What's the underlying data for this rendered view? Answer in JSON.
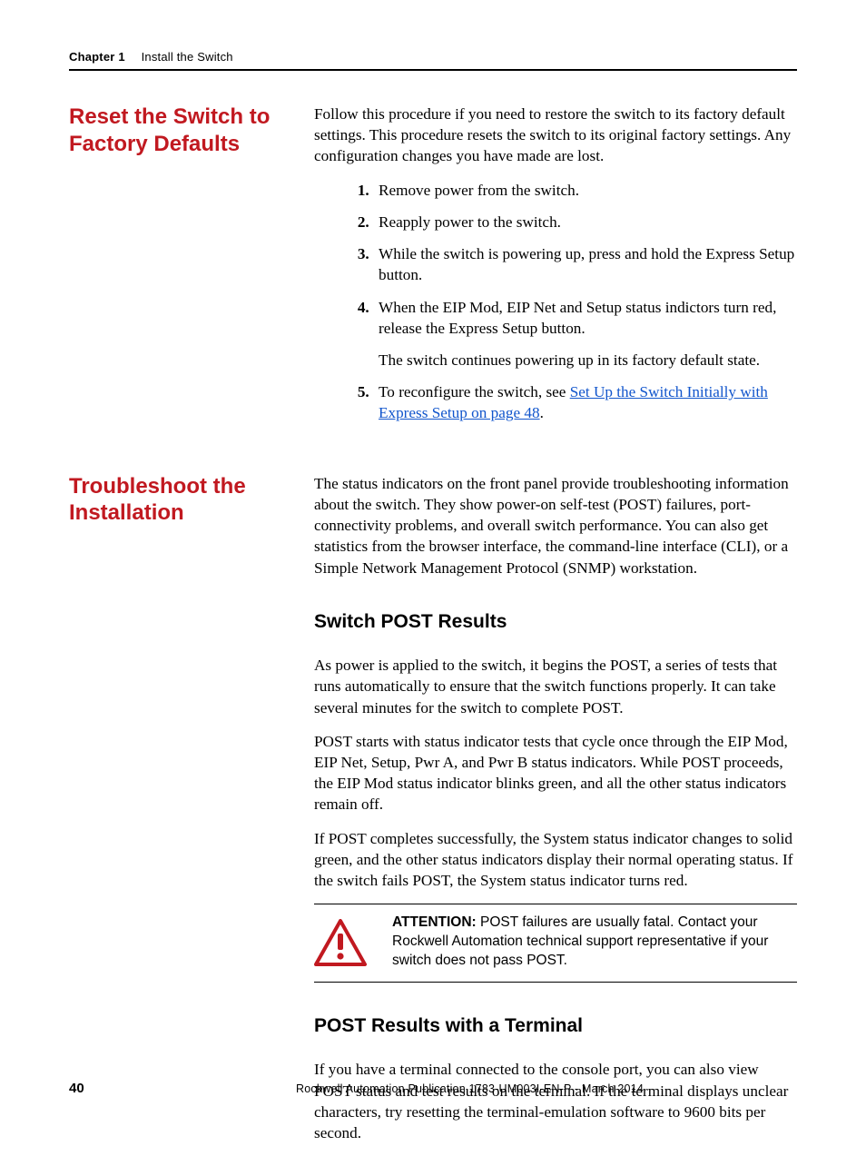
{
  "header": {
    "chapter": "Chapter 1",
    "title": "Install the Switch"
  },
  "section1": {
    "heading": "Reset the Switch to Factory Defaults",
    "intro": "Follow this procedure if you need to restore the switch to its factory default settings. This procedure resets the switch to its original factory settings. Any configuration changes you have made are lost.",
    "steps": {
      "s1": "Remove power from the switch.",
      "s2": "Reapply power to the switch.",
      "s3": "While the switch is powering up, press and hold the Express Setup button.",
      "s4": "When the EIP Mod, EIP Net and Setup status indictors turn red, release the Express Setup button.",
      "s4_cont": "The switch continues powering up in its factory default state.",
      "s5_pre": "To reconfigure the switch, see ",
      "s5_link": "Set Up the Switch Initially with Express Setup on page 48",
      "s5_post": "."
    }
  },
  "section2": {
    "heading": "Troubleshoot the Installation",
    "intro": "The status indicators on the front panel provide troubleshooting information about the switch. They show power-on self-test (POST) failures, port-connectivity problems, and overall switch performance. You can also get statistics from the browser interface, the command-line interface (CLI), or a Simple Network Management Protocol (SNMP) workstation.",
    "sub1": {
      "heading": "Switch POST Results",
      "p1": "As power is applied to the switch, it begins the POST, a series of tests that runs automatically to ensure that the switch functions properly. It can take several minutes for the switch to complete POST.",
      "p2": "POST starts with status indicator tests that cycle once through the EIP Mod, EIP Net, Setup, Pwr A, and Pwr B status indicators. While POST proceeds, the EIP Mod status indicator blinks green, and all the other status indicators remain off.",
      "p3": "If POST completes successfully, the System status indicator changes to solid green, and the other status indicators display their normal operating status. If the switch fails POST, the System status indicator turns red."
    },
    "attention": {
      "label": "ATTENTION: ",
      "text": "POST failures are usually fatal. Contact your Rockwell Automation technical support representative if your switch does not pass POST."
    },
    "sub2": {
      "heading": "POST Results with a Terminal",
      "p1": "If you have a terminal connected to the console port, you can also view POST status and test results on the terminal. If the terminal displays unclear characters, try resetting the terminal-emulation software to 9600 bits per second."
    }
  },
  "footer": {
    "page": "40",
    "pub": "Rockwell Automation Publication 1783-UM003I-EN-P - March 2014"
  }
}
